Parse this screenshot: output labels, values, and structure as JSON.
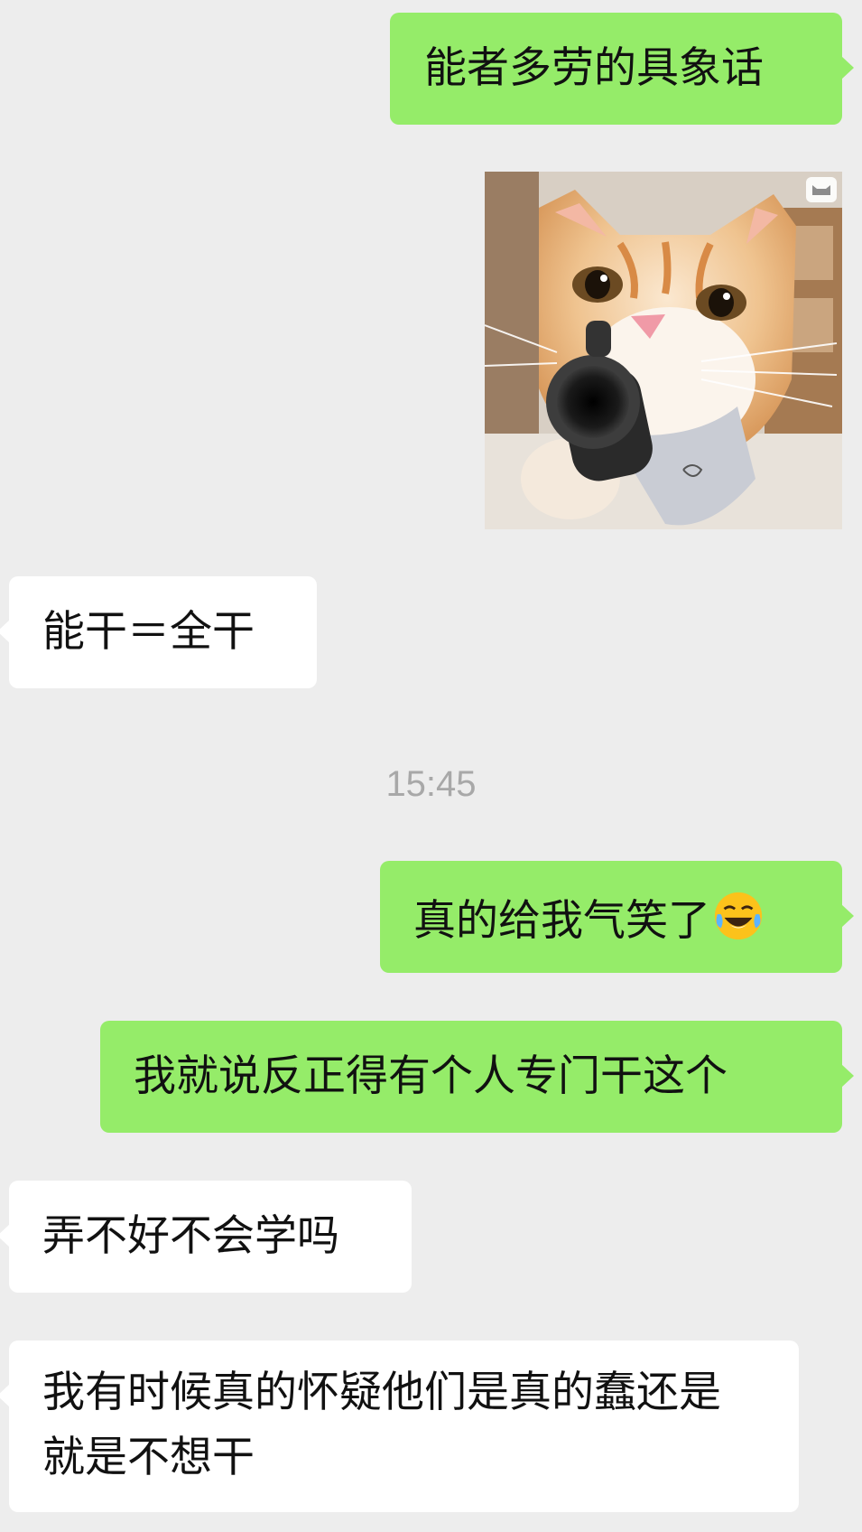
{
  "chat": {
    "messages": [
      {
        "side": "sent",
        "type": "text",
        "text": "能者多劳的具象话"
      },
      {
        "side": "sent",
        "type": "sticker",
        "sticker": "cat-with-gun"
      },
      {
        "side": "received",
        "type": "text",
        "text": "能干＝全干"
      },
      {
        "type": "time",
        "text": "15:45"
      },
      {
        "side": "sent",
        "type": "text",
        "text": "真的给我气笑了",
        "emoji": "face-with-tears-of-joy"
      },
      {
        "side": "sent",
        "type": "text",
        "text": "我就说反正得有个人专门干这个"
      },
      {
        "side": "received",
        "type": "text",
        "text": "弄不好不会学吗"
      },
      {
        "side": "received",
        "type": "text",
        "text": "我有时候真的怀疑他们是真的蠢还是就是不想干"
      }
    ]
  },
  "colors": {
    "background": "#ededed",
    "sent_bubble": "#95ec69",
    "received_bubble": "#ffffff",
    "timestamp": "#a8a8a8"
  }
}
